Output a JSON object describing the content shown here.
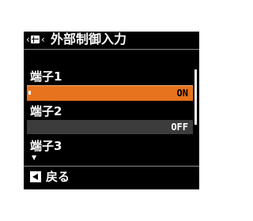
{
  "header": {
    "breadcrumb_arrow": "‹",
    "title": "外部制御入力"
  },
  "items": [
    {
      "label": "端子1",
      "value": "ON"
    },
    {
      "label": "端子2",
      "value": "OFF"
    },
    {
      "label": "端子3"
    }
  ],
  "footer": {
    "back_label": "戻る"
  }
}
